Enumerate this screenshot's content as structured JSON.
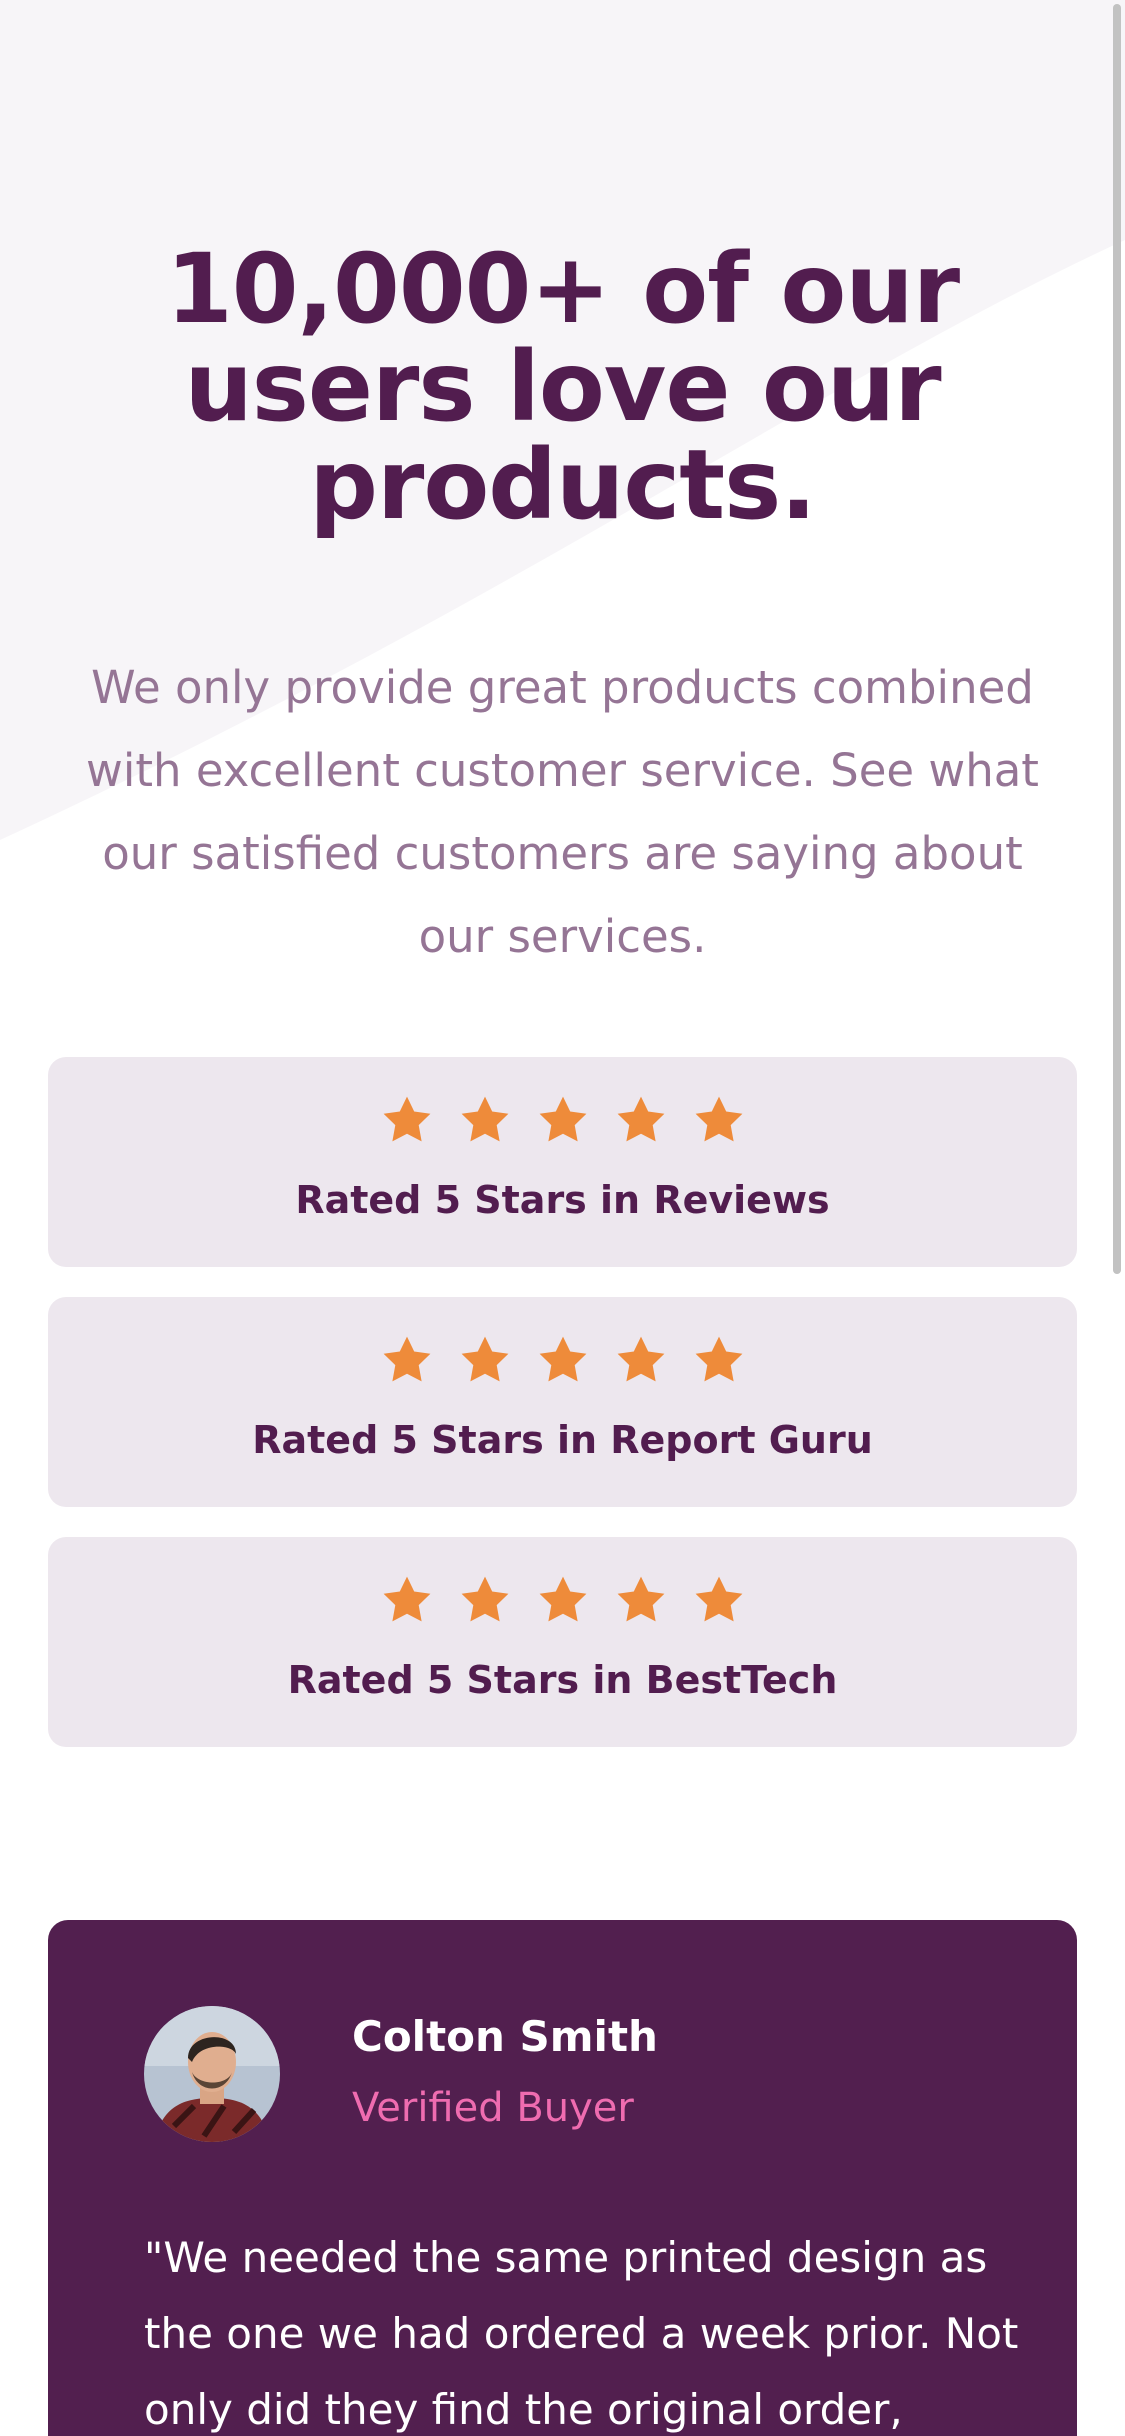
{
  "hero": {
    "headline": "10,000+ of our users love our products.",
    "intro": "We only provide great products combined with excellent customer service. See what our satisfied customers are saying about our services."
  },
  "ratings": [
    {
      "label": "Rated 5 Stars in Reviews",
      "stars": 5
    },
    {
      "label": "Rated 5 Stars in Report Guru",
      "stars": 5
    },
    {
      "label": "Rated 5 Stars in BestTech",
      "stars": 5
    }
  ],
  "testimonial": {
    "name": "Colton Smith",
    "role": "Verified Buyer",
    "quote": "\"We needed the same printed design as the one we had ordered a week prior. Not only did they find the original order,"
  },
  "colors": {
    "primary": "#521d4f",
    "muted": "#957595",
    "card_bg": "#ede7ee",
    "star": "#ee8b3a",
    "accent_pink": "#ef6cb0"
  },
  "icons": {
    "star": "star-icon"
  }
}
